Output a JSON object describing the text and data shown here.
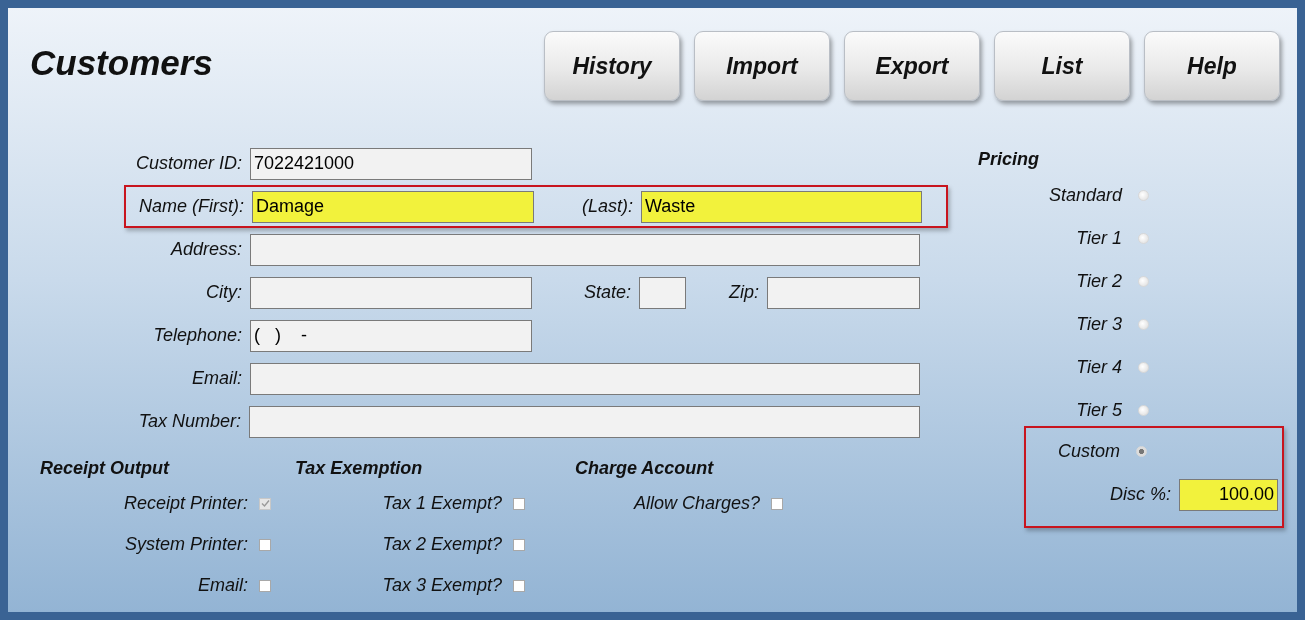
{
  "title": "Customers",
  "buttons": [
    "History",
    "Import",
    "Export",
    "List",
    "Help"
  ],
  "customer_form": {
    "rows": [
      {
        "fields": [
          {
            "label": "Customer ID:",
            "value": "7022421000",
            "highlighted": false
          }
        ]
      },
      {
        "outlined": true,
        "fields": [
          {
            "label": "Name (First):",
            "value": "Damage",
            "highlighted": true
          },
          {
            "label": "(Last):",
            "value": "Waste",
            "highlighted": true
          }
        ]
      },
      {
        "fields": [
          {
            "label": "Address:",
            "highlighted": false
          }
        ]
      },
      {
        "fields": [
          {
            "label": "City:",
            "highlighted": false
          },
          {
            "label": "State:",
            "highlighted": false
          },
          {
            "label": "Zip:",
            "highlighted": false
          }
        ]
      },
      {
        "fields": [
          {
            "label": "Telephone:",
            "value": "(   )    -",
            "highlighted": false
          }
        ]
      },
      {
        "fields": [
          {
            "label": "Email:",
            "highlighted": false
          }
        ]
      },
      {
        "fields": [
          {
            "label": "Tax Number:",
            "highlighted": false
          }
        ]
      }
    ]
  },
  "sections": [
    {
      "title": "Receipt Output",
      "options": [
        {
          "label": "Receipt Printer:",
          "checked": true,
          "disabled": true
        },
        {
          "label": "System Printer:",
          "checked": false,
          "disabled": false
        },
        {
          "label": "Email:",
          "checked": false,
          "disabled": false
        }
      ]
    },
    {
      "title": "Tax Exemption",
      "options": [
        {
          "label": "Tax 1 Exempt?",
          "checked": false,
          "disabled": false
        },
        {
          "label": "Tax 2 Exempt?",
          "checked": false,
          "disabled": false
        },
        {
          "label": "Tax 3 Exempt?",
          "checked": false,
          "disabled": false
        }
      ]
    },
    {
      "title": "Charge Account",
      "options": [
        {
          "label": "Allow Charges?",
          "checked": false,
          "disabled": false
        }
      ]
    }
  ],
  "pricing": {
    "title": "Pricing",
    "outlined": true,
    "options": [
      {
        "label": "Standard",
        "selected": false
      },
      {
        "label": "Tier 1",
        "selected": false
      },
      {
        "label": "Tier 2",
        "selected": false
      },
      {
        "label": "Tier 3",
        "selected": false
      },
      {
        "label": "Tier 4",
        "selected": false
      },
      {
        "label": "Tier 5",
        "selected": false
      },
      {
        "label": "Custom",
        "selected": true
      }
    ],
    "discount": {
      "label": "Disc %:",
      "value": "100.00",
      "highlighted": true
    }
  }
}
